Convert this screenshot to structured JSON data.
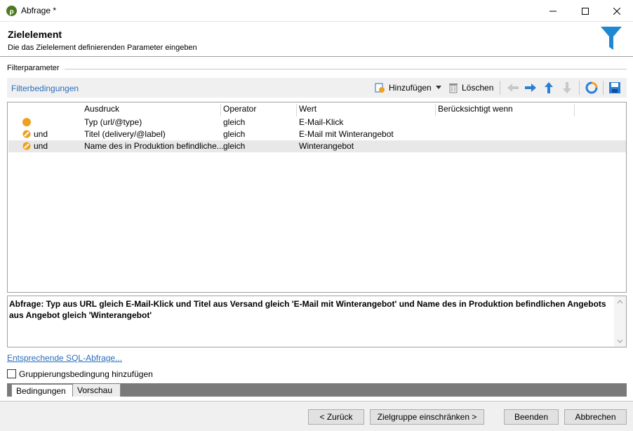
{
  "window": {
    "title": "Abfrage *"
  },
  "header": {
    "title": "Zielelement",
    "subtitle": "Die das Zielelement definierenden Parameter eingeben"
  },
  "group": {
    "label": "Filterparameter"
  },
  "toolbar": {
    "title": "Filterbedingungen",
    "add_label": "Hinzufügen",
    "delete_label": "Löschen"
  },
  "grid": {
    "columns": [
      "Ausdruck",
      "Operator",
      "Wert",
      "Berücksichtigt wenn"
    ],
    "rows": [
      {
        "conj": "",
        "expr": "Typ (url/@type)",
        "op": "gleich",
        "value": "E-Mail-Klick",
        "when": ""
      },
      {
        "conj": "und",
        "expr": "Titel (delivery/@label)",
        "op": "gleich",
        "value": "E-Mail mit Winterangebot",
        "when": ""
      },
      {
        "conj": "und",
        "expr": "Name des in Produktion befindliche...",
        "op": "gleich",
        "value": "Winterangebot",
        "when": ""
      }
    ]
  },
  "query": {
    "text": "Abfrage: Typ aus URL gleich E-Mail-Klick und Titel aus Versand gleich 'E-Mail mit Winterangebot' und Name des in Produktion befindlichen Angebots aus Angebot gleich 'Winterangebot'"
  },
  "sql_link": "Entsprechende SQL-Abfrage...",
  "grouping_checkbox": {
    "label": "Gruppierungsbedingung hinzufügen",
    "checked": false
  },
  "tabs": [
    {
      "label": "Bedingungen",
      "active": true
    },
    {
      "label": "Vorschau",
      "active": false
    }
  ],
  "footer": {
    "back": "< Zurück",
    "restrict": "Zielgruppe einschränken >",
    "finish": "Beenden",
    "cancel": "Abbrechen"
  },
  "colors": {
    "accent": "#2a6ebb",
    "funnel": "#1e88d2",
    "dot": "#f0a020"
  }
}
